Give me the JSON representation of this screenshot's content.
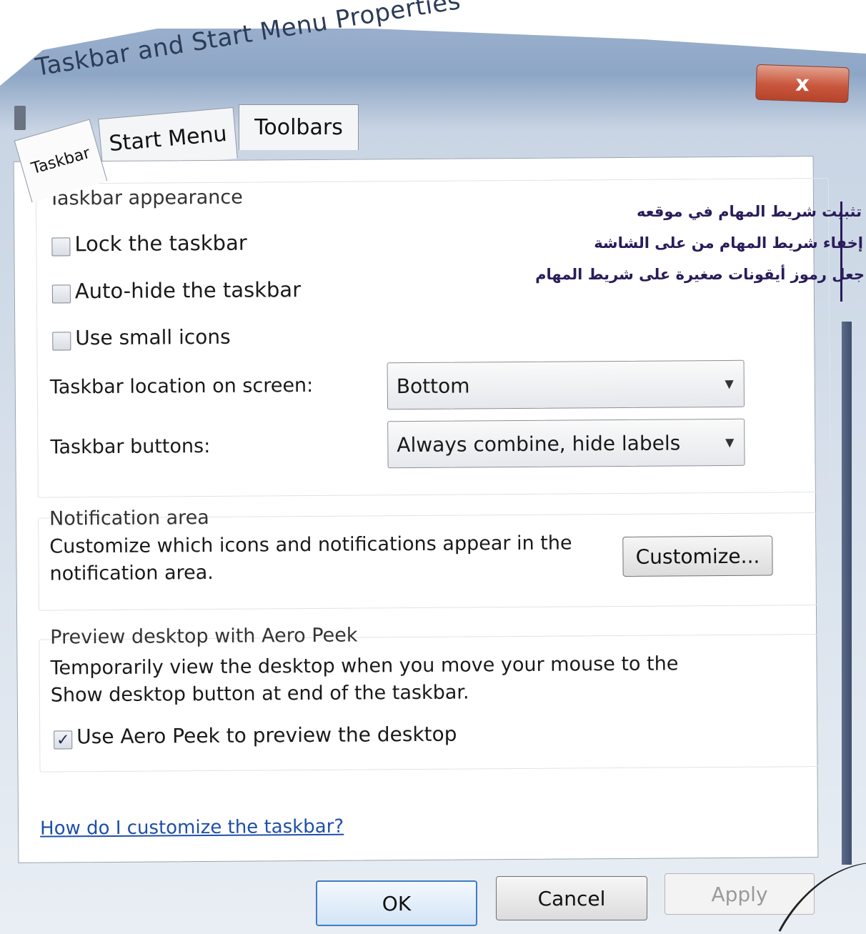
{
  "window": {
    "title": "Taskbar and Start Menu Properties",
    "close_label": "x"
  },
  "tabs": [
    {
      "label": "Taskbar",
      "selected": true
    },
    {
      "label": "Start Menu",
      "selected": false
    },
    {
      "label": "Toolbars",
      "selected": false
    }
  ],
  "appearance": {
    "heading": "Taskbar appearance",
    "lock_label": "Lock the taskbar",
    "lock_checked": false,
    "autohide_label": "Auto-hide the taskbar",
    "autohide_checked": false,
    "small_icons_label": "Use small icons",
    "small_icons_checked": false,
    "location_label": "Taskbar location on screen:",
    "location_value": "Bottom",
    "buttons_label": "Taskbar buttons:",
    "buttons_value": "Always combine, hide labels"
  },
  "notification": {
    "heading": "Notification area",
    "description": "Customize which icons and notifications appear in the notification area.",
    "customize_label": "Customize..."
  },
  "peek": {
    "heading": "Preview desktop with Aero Peek",
    "description": "Temporarily view the desktop when you move your mouse to the Show desktop button at end of the taskbar.",
    "checkbox_label": "Use Aero Peek to preview the desktop",
    "checkbox_checked": true,
    "check_glyph": "✓"
  },
  "help_link": "How do I customize the taskbar?",
  "annotations": [
    "تثبيت شريط المهام في موقعه",
    "إخفاء شريط المهام من على الشاشة",
    "جعل رموز أيقونات صغيرة على شريط المهام"
  ],
  "footer": {
    "ok_label": "OK",
    "cancel_label": "Cancel",
    "apply_label": "Apply"
  },
  "icons": {
    "dropdown": "▼"
  }
}
